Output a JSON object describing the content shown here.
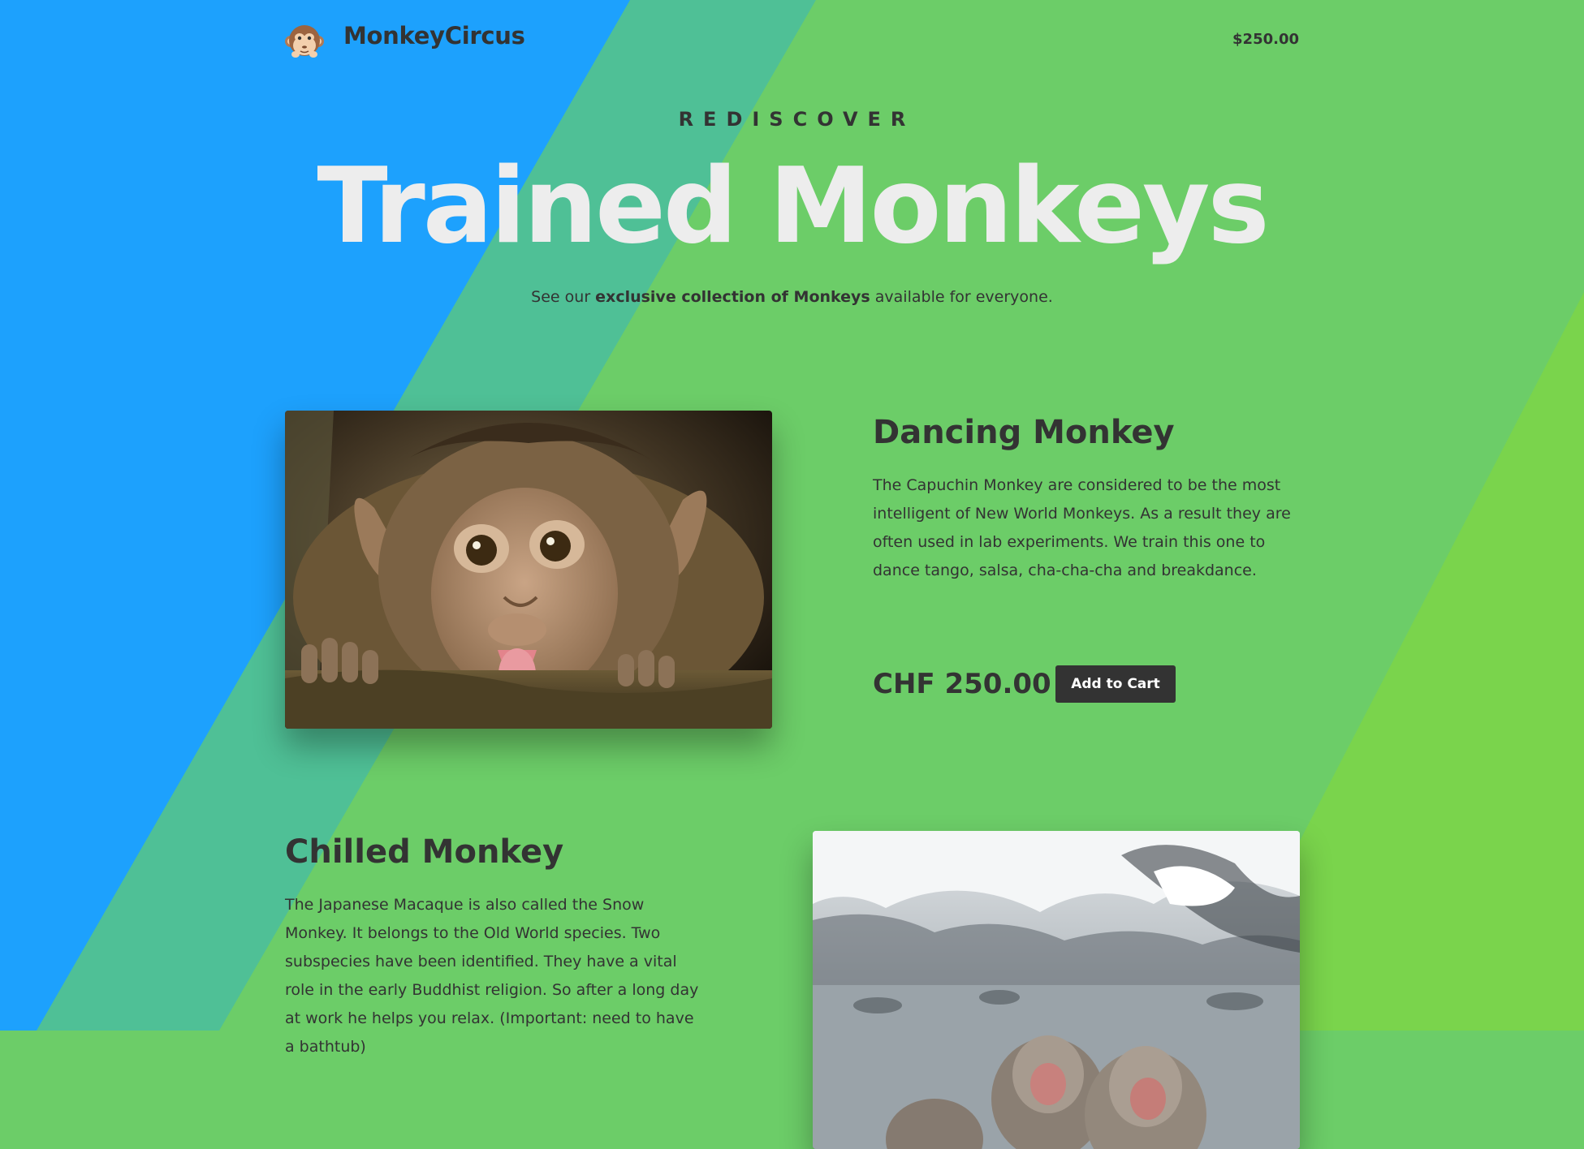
{
  "header": {
    "brand": "MonkeyCircus",
    "cart_total": "$250.00"
  },
  "hero": {
    "eyebrow": "REDISCOVER",
    "title": "Trained Monkeys",
    "subtitle_pre": "See our ",
    "subtitle_bold": "exclusive collection of Monkeys",
    "subtitle_post": " available for everyone."
  },
  "products": [
    {
      "title": "Dancing Monkey",
      "description": "The Capuchin Monkey are considered to be the most intelligent of New World Monkeys. As a result they are often used in lab experiments. We train this one to dance tango, salsa, cha-cha-cha and breakdance.",
      "price": "CHF 250.00",
      "button": "Add to Cart"
    },
    {
      "title": "Chilled Monkey",
      "description": "The Japanese Macaque is also called the Snow Monkey. It belongs to the Old World species. Two subspecies have been identified. They have a vital role in the early Buddhist religion. So after a long day at work he helps you relax. (Important: need to have a bathtub)"
    }
  ],
  "icons": {
    "logo": "monkey-face-icon"
  },
  "colors": {
    "background_blue": "#1da1fd",
    "background_teal": "#4fc096",
    "background_green": "#6ccd68",
    "background_lime": "#7cd44a",
    "text_dark": "#333333",
    "hero_title": "#ededed",
    "button_bg": "#333333"
  }
}
